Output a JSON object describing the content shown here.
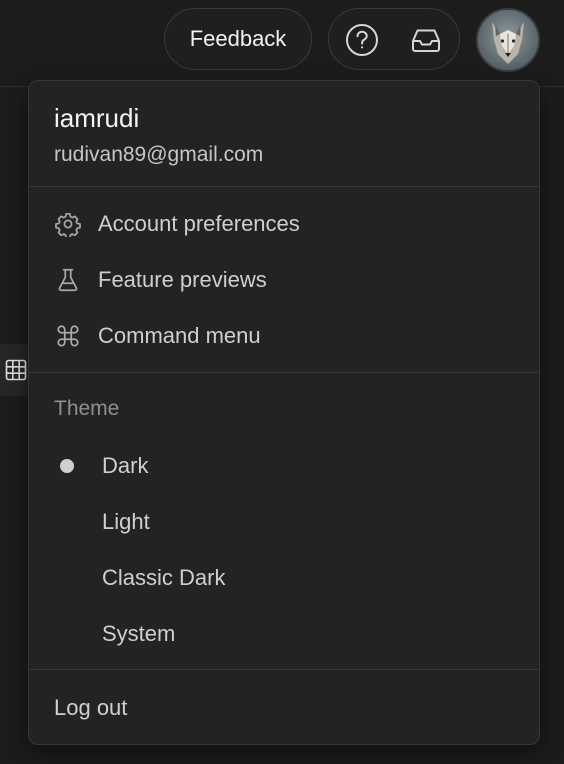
{
  "header": {
    "feedback_label": "Feedback",
    "help_icon": "help-circle-icon",
    "inbox_icon": "inbox-icon",
    "avatar_icon": "wolf-avatar"
  },
  "menu": {
    "user": {
      "name": "iamrudi",
      "email": "rudivan89@gmail.com"
    },
    "items": [
      {
        "label": "Account preferences",
        "icon": "gear-icon"
      },
      {
        "label": "Feature previews",
        "icon": "flask-icon"
      },
      {
        "label": "Command menu",
        "icon": "command-icon"
      }
    ],
    "theme": {
      "title": "Theme",
      "selected": "Dark",
      "options": [
        "Dark",
        "Light",
        "Classic Dark",
        "System"
      ]
    },
    "logout_label": "Log out"
  },
  "colors": {
    "background": "#1c1c1c",
    "menu_background": "#232323",
    "border": "#363636",
    "text_primary": "#f5f5f5",
    "text_secondary": "#cfcfcf",
    "text_muted": "#8f8f8f"
  }
}
